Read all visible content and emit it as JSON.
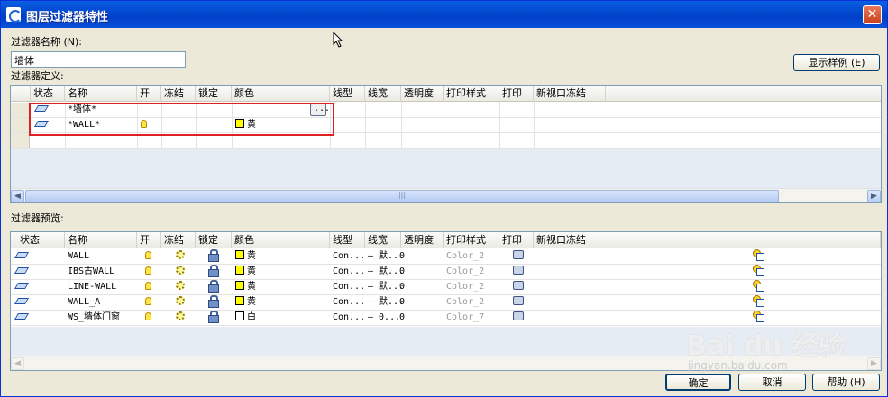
{
  "window": {
    "title": "图层过滤器特性",
    "close_glyph": "✕"
  },
  "filter_name": {
    "label": "过滤器名称 (N):",
    "value": "墙体"
  },
  "show_example_button": "显示样例 (E)",
  "definition": {
    "label": "过滤器定义:",
    "columns": [
      "状态",
      "名称",
      "开",
      "冻结",
      "锁定",
      "颜色",
      "线型",
      "线宽",
      "透明度",
      "打印样式",
      "打印",
      "新视口冻结"
    ],
    "rows": [
      {
        "name": "*墙体*",
        "on": "",
        "color_label": "",
        "color_hex": ""
      },
      {
        "name": "*WALL*",
        "on": "bulb",
        "color_label": "黄",
        "color_hex": "#ffff00"
      }
    ]
  },
  "preview": {
    "label": "过滤器预览:",
    "columns": [
      "状态",
      "名称",
      "开",
      "冻结",
      "锁定",
      "颜色",
      "线型",
      "线宽",
      "透明度",
      "打印样式",
      "打印",
      "新视口冻结"
    ],
    "rows": [
      {
        "name": "WALL",
        "color_label": "黄",
        "color_hex": "#ffff00",
        "linetype": "Con...",
        "lineweight": "— 默...",
        "transparency": "0",
        "plotstyle": "Color_2"
      },
      {
        "name": "IBS古WALL",
        "color_label": "黄",
        "color_hex": "#ffff00",
        "linetype": "Con...",
        "lineweight": "— 默...",
        "transparency": "0",
        "plotstyle": "Color_2"
      },
      {
        "name": "LINE-WALL",
        "color_label": "黄",
        "color_hex": "#ffff00",
        "linetype": "Con...",
        "lineweight": "— 默...",
        "transparency": "0",
        "plotstyle": "Color_2"
      },
      {
        "name": "WALL_A",
        "color_label": "黄",
        "color_hex": "#ffff00",
        "linetype": "Con...",
        "lineweight": "— 默...",
        "transparency": "0",
        "plotstyle": "Color_2"
      },
      {
        "name": "WS_墙体门窗",
        "color_label": "白",
        "color_hex": "#ffffff",
        "linetype": "Con...",
        "lineweight": "— 0...",
        "transparency": "0",
        "plotstyle": "Color_7"
      }
    ]
  },
  "buttons": {
    "ok": "确定",
    "cancel": "取消",
    "help": "帮助 (H)"
  },
  "scroll": {
    "left": "◀",
    "right": "▶",
    "thumb": "|||"
  },
  "watermark": {
    "main": "Bai du 经验",
    "sub": "jingyan.baidu.com"
  }
}
